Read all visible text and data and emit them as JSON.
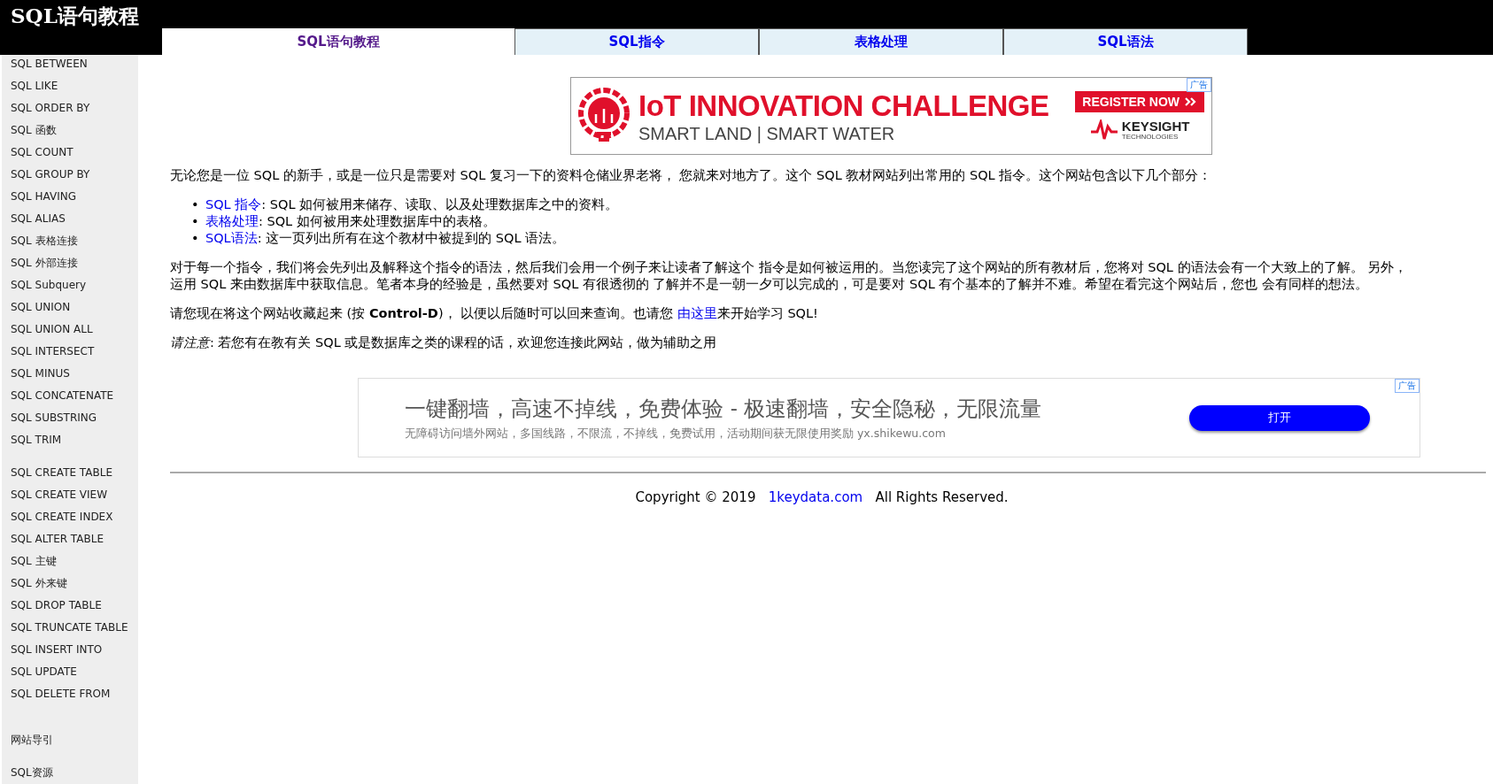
{
  "header": {
    "title": "SQL语句教程"
  },
  "tabs": [
    {
      "label": "SQL语句教程",
      "selected": true
    },
    {
      "label": "SQL指令",
      "selected": false
    },
    {
      "label": "表格处理",
      "selected": false
    },
    {
      "label": "SQL语法",
      "selected": false
    }
  ],
  "sidebar": {
    "groups": [
      [
        "SQL BETWEEN",
        "SQL LIKE",
        "SQL ORDER BY",
        "SQL 函数",
        "SQL COUNT",
        "SQL GROUP BY",
        "SQL HAVING",
        "SQL ALIAS",
        "SQL 表格连接",
        "SQL 外部连接",
        "SQL Subquery",
        "SQL UNION",
        "SQL UNION ALL",
        "SQL INTERSECT",
        "SQL MINUS",
        "SQL CONCATENATE",
        "SQL SUBSTRING",
        "SQL TRIM"
      ],
      [
        "SQL CREATE TABLE",
        "SQL CREATE VIEW",
        "SQL CREATE INDEX",
        "SQL ALTER TABLE",
        "SQL 主键",
        "SQL 外来键",
        "SQL DROP TABLE",
        "SQL TRUNCATE TABLE",
        "SQL INSERT INTO",
        "SQL UPDATE",
        "SQL DELETE FROM"
      ],
      [
        "网站导引"
      ],
      [
        "SQL资源"
      ]
    ]
  },
  "banner_ad": {
    "badge": "广告",
    "headline": "IoT INNOVATION CHALLENGE",
    "subline": "SMART LAND | SMART WATER",
    "cta": "REGISTER NOW",
    "brand": "KEYSIGHT",
    "brand_sub": "TECHNOLOGIES"
  },
  "intro": "无论您是一位 SQL 的新手，或是一位只是需要对 SQL 复习一下的资料仓储业界老将， 您就来对地方了。这个 SQL 教材网站列出常用的 SQL 指令。这个网站包含以下几个部分：",
  "topics": [
    {
      "bullet": "•",
      "link": "SQL 指令",
      "text": ": SQL 如何被用来储存、读取、以及处理数据库之中的资料。"
    },
    {
      "bullet": "•",
      "link": "表格处理",
      "text": ": SQL 如何被用来处理数据库中的表格。"
    },
    {
      "bullet": "•",
      "link": "SQL语法",
      "text": ": 这一页列出所有在这个教材中被提到的 SQL 语法。"
    }
  ],
  "explanation_lines": [
    "对于每一个指令，我们将会先列出及解释这个指令的语法，然后我们会用一个例子来让读者了解这个 指令是如何被运用的。当您读完了这个网站的所有教材后，您将对 SQL 的语法会有一个大致上的了解。 另外，",
    "运用 SQL 来由数据库中获取信息。笔者本身的经验是，虽然要对 SQL 有很透彻的 了解并不是一朝一夕可以完成的，可是要对 SQL 有个基本的了解并不难。希望在看完这个网站后，您也 会有同样的想法。"
  ],
  "bookmark": {
    "before": "请您现在将这个网站收藏起来 (按 **Control-D**)， 以便以后随时可以回来查询。也请您 ",
    "link": "由这里",
    "after": "来开始学习 SQL!"
  },
  "note": "*请注意*: 若您有在教有关 SQL 或是数据库之类的课程的话，欢迎您连接此网站，做为辅助之用",
  "text_ad": {
    "badge": "广告",
    "headline": "一键翻墙，高速不掉线，免费体验 - 极速翻墙，安全隐秘，无限流量",
    "subline": "无障碍访问墙外网站，多国线路，不限流，不掉线，免费试用，活动期间获无限使用奖励 yx.shikewu.com",
    "button": "打开"
  },
  "footer": {
    "copyright": "Copyright © 2019",
    "link": "1keydata.com",
    "rights": "All Rights Reserved."
  }
}
